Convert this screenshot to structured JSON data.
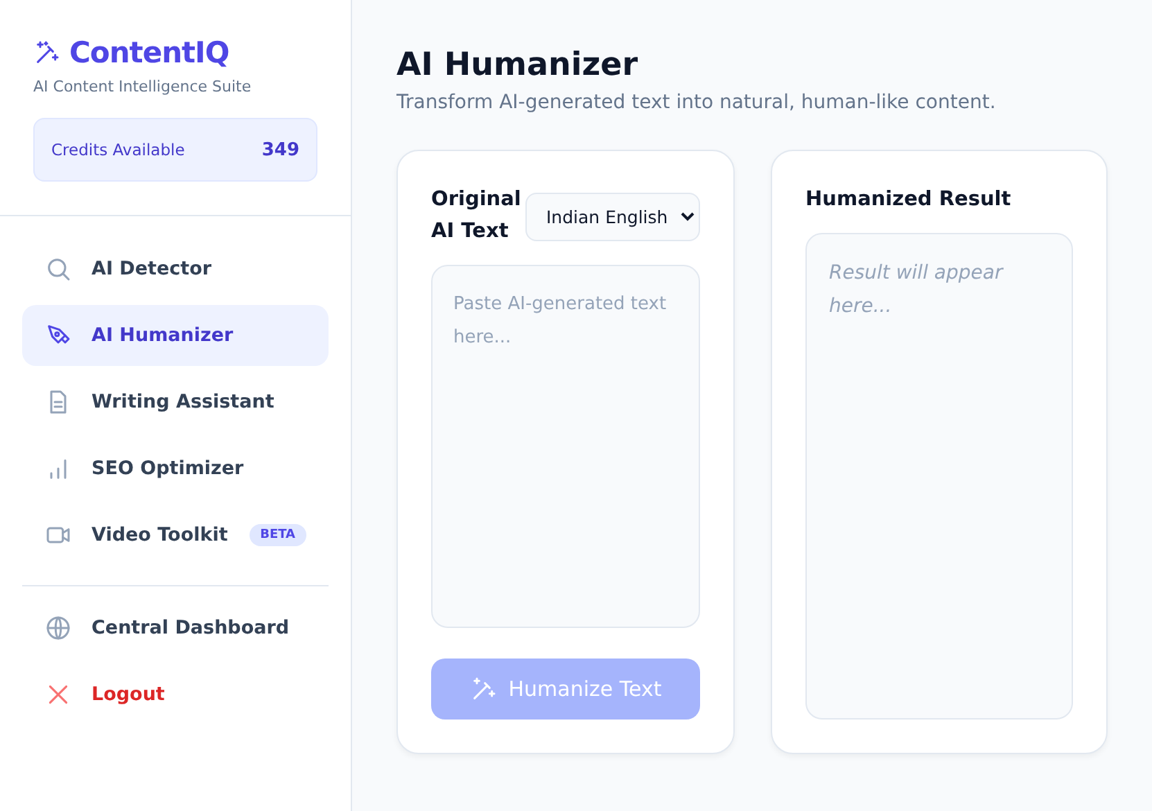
{
  "brand": {
    "name": "ContentIQ",
    "tagline": "AI Content Intelligence Suite"
  },
  "credits": {
    "label": "Credits Available",
    "value": "349"
  },
  "nav": [
    {
      "label": "AI Detector",
      "selected": false
    },
    {
      "label": "AI Humanizer",
      "selected": true
    },
    {
      "label": "Writing Assistant",
      "selected": false
    },
    {
      "label": "SEO Optimizer",
      "selected": false
    },
    {
      "label": "Video Toolkit",
      "selected": false,
      "badge": "BETA"
    }
  ],
  "footer_nav": [
    {
      "label": "Central Dashboard",
      "kind": "link"
    },
    {
      "label": "Logout",
      "kind": "danger"
    }
  ],
  "page": {
    "title": "AI Humanizer",
    "subtitle": "Transform AI-generated text into natural, human-like content."
  },
  "input_card": {
    "label": "Original AI Text",
    "dialect": "Indian English",
    "placeholder": "Paste AI-generated text here...",
    "button": {
      "label": "Humanize Text",
      "disabled": true
    }
  },
  "result_card": {
    "title": "Humanized Result",
    "placeholder": "Result will appear here..."
  }
}
